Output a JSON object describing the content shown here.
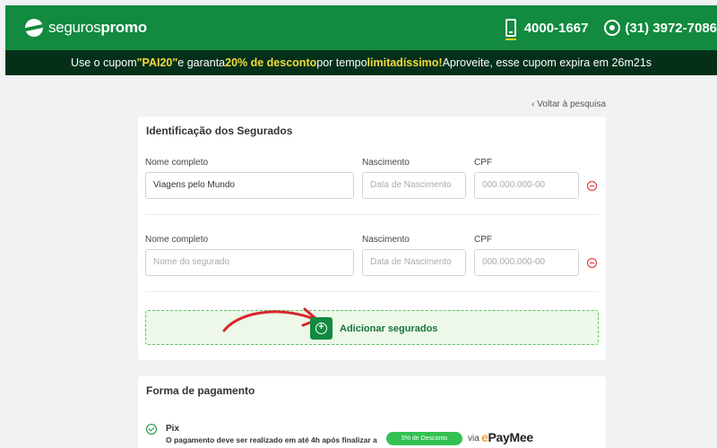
{
  "header": {
    "logo_prefix": "seguros",
    "logo_bold": "promo",
    "phone": "4000-1667",
    "whatsapp": "(31) 3972-7086"
  },
  "promo": {
    "part1": "Use o cupom ",
    "code": "\"PAI20\"",
    "part2": " e garanta ",
    "discount": "20% de desconto",
    "part3": " por tempo ",
    "limited": "limitadíssimo!",
    "part4": " Aproveite, esse cupom expira em 26m21s"
  },
  "back_link": "‹ Voltar à pesquisa",
  "insured": {
    "title": "Identificação dos Segurados",
    "labels": {
      "name": "Nome completo",
      "birth": "Nascimento",
      "cpf": "CPF"
    },
    "rows": [
      {
        "name_value": "Viagens pelo Mundo",
        "birth_placeholder": "Data de Nascimento",
        "cpf_placeholder": "000.000.000-00"
      },
      {
        "name_placeholder": "Nome do segurado",
        "birth_placeholder": "Data de Nascimento",
        "cpf_placeholder": "000.000.000-00"
      }
    ],
    "add_label": "Adicionar segurados"
  },
  "payment": {
    "title": "Forma de pagamento",
    "option_title": "Pix",
    "option_desc": "O pagamento deve ser realizado em até 4h após finalizar a",
    "badge": "5% de Desconto",
    "via": "via",
    "provider": "PayMee"
  },
  "colors": {
    "brand_green": "#128a3f",
    "promo_bg": "#04301a",
    "highlight": "#f4d93b",
    "remove_red": "#e02424",
    "arrow_red": "#d7262b"
  },
  "icons": [
    "phone-icon",
    "whatsapp-icon",
    "minus-circle-icon",
    "plus-circle-icon",
    "check-circle-icon"
  ]
}
